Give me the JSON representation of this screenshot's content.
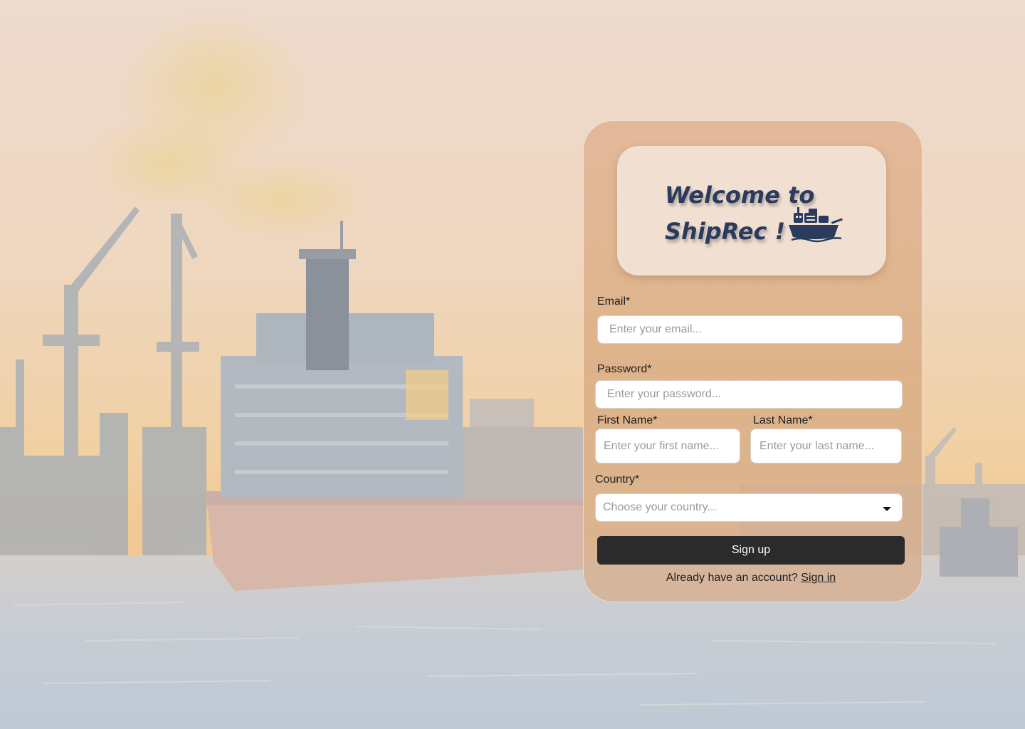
{
  "welcome": {
    "title": "Welcome to ShipRec !",
    "icon": "cargo-ship-icon"
  },
  "form": {
    "email": {
      "label": "Email*",
      "placeholder": "Enter your email..."
    },
    "password": {
      "label": "Password*",
      "placeholder": "Enter your password..."
    },
    "first_name": {
      "label": "First Name*",
      "placeholder": "Enter your first name..."
    },
    "last_name": {
      "label": "Last Name*",
      "placeholder": "Enter your last name..."
    },
    "country": {
      "label": "Country*",
      "placeholder": "Choose your country..."
    },
    "submit_label": "Sign up"
  },
  "footer": {
    "prompt": "Already have an account?",
    "link_label": "Sign in"
  },
  "colors": {
    "title": "#2a3b5e",
    "button": "#2b2b2b",
    "card": "#e0b696"
  }
}
